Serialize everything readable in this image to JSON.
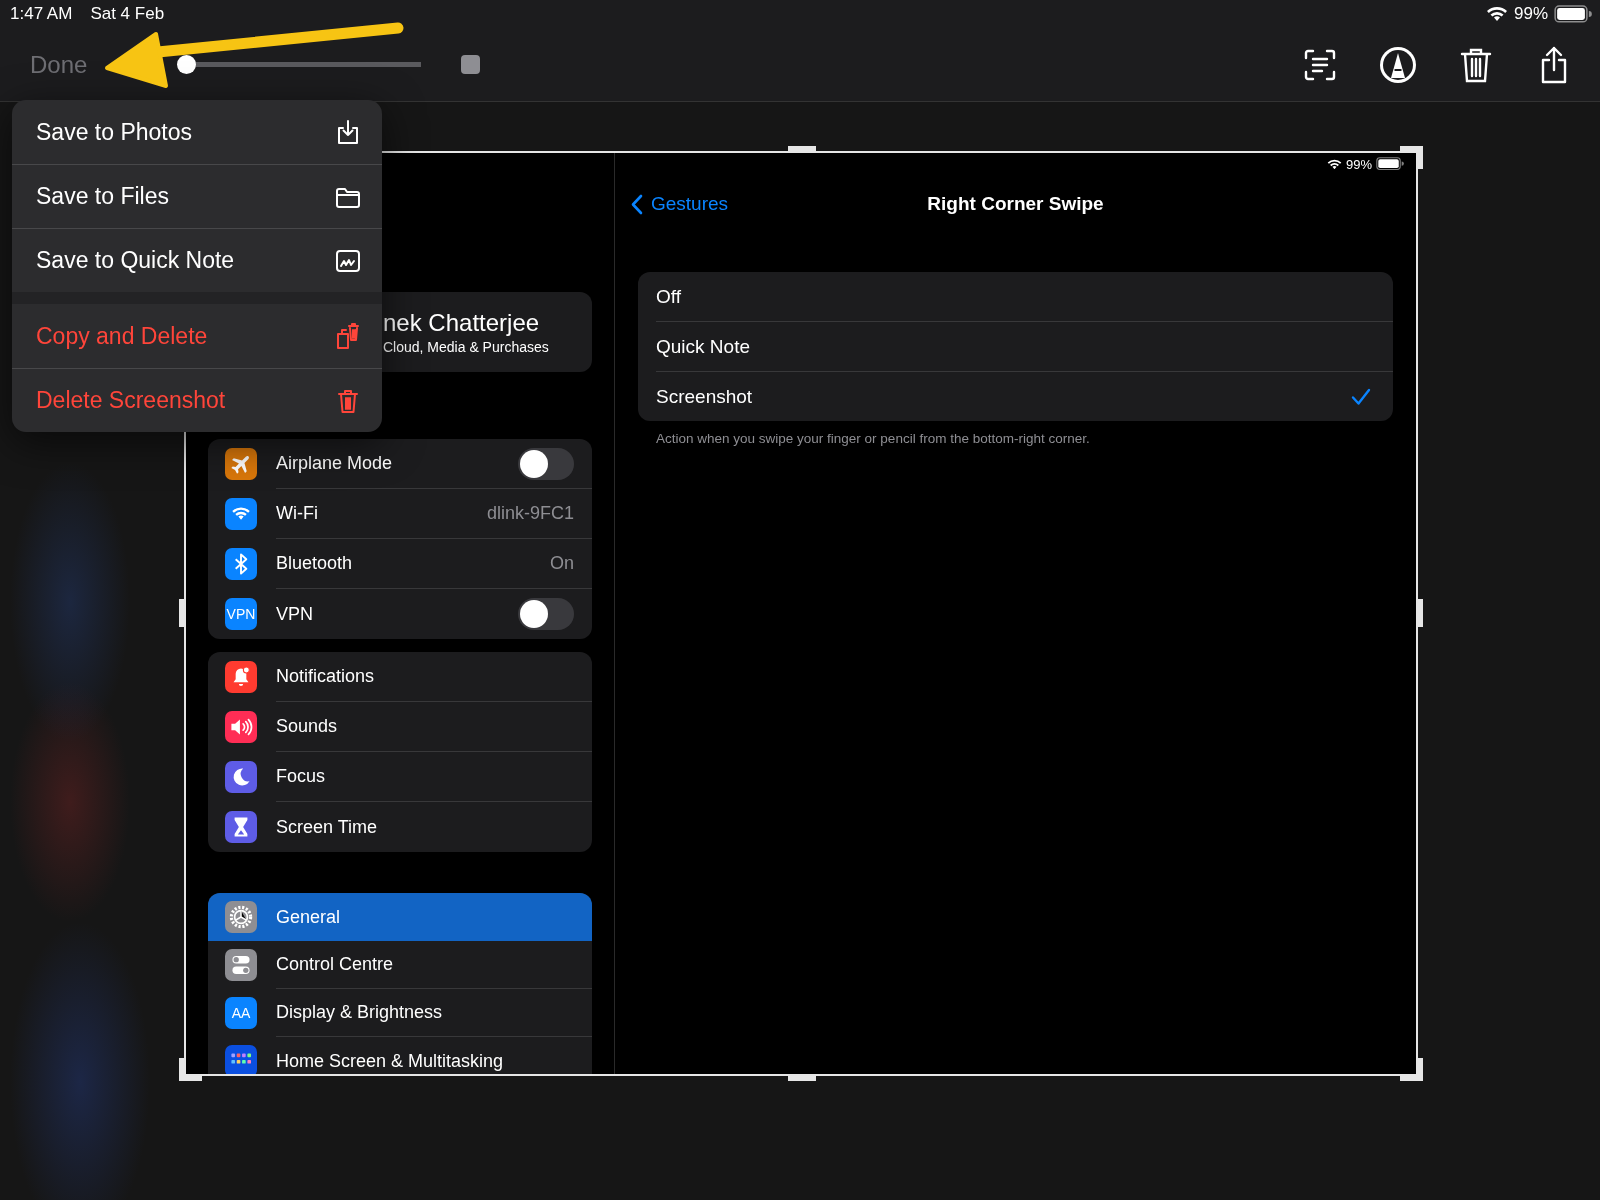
{
  "status_bar": {
    "time": "1:47 AM",
    "date": "Sat 4 Feb",
    "battery": "99%"
  },
  "toolbar": {
    "done": "Done",
    "slider": {
      "level": 0
    }
  },
  "menu": {
    "groups": [
      {
        "items": [
          {
            "label": "Save to Photos",
            "kind": "photos",
            "destructive": false
          },
          {
            "label": "Save to Files",
            "kind": "files",
            "destructive": false
          },
          {
            "label": "Save to Quick Note",
            "kind": "note",
            "destructive": false
          }
        ]
      },
      {
        "items": [
          {
            "label": "Copy and Delete",
            "kind": "copydelete",
            "destructive": true
          },
          {
            "label": "Delete Screenshot",
            "kind": "delete",
            "destructive": true
          }
        ]
      }
    ]
  },
  "preview": {
    "status_bar": {
      "battery": "99%"
    },
    "sidebar": {
      "account": {
        "name": "nek Chatterjee",
        "subtitle": "Cloud, Media & Purchases"
      },
      "groups": [
        {
          "items": [
            {
              "label": "Airplane Mode",
              "kind": "toggle",
              "on": false,
              "selected": false
            },
            {
              "label": "Wi-Fi",
              "kind": "value",
              "value": "dlink-9FC1",
              "selected": false
            },
            {
              "label": "Bluetooth",
              "kind": "value",
              "value": "On",
              "selected": false
            },
            {
              "label": "VPN",
              "kind": "toggle",
              "on": false,
              "icon_text": "VPN",
              "selected": false
            }
          ]
        },
        {
          "items": [
            {
              "label": "Notifications",
              "kind": "link",
              "selected": false
            },
            {
              "label": "Sounds",
              "kind": "link",
              "selected": false
            },
            {
              "label": "Focus",
              "kind": "link",
              "selected": false
            },
            {
              "label": "Screen Time",
              "kind": "link",
              "selected": false
            }
          ]
        },
        {
          "items": [
            {
              "label": "General",
              "kind": "link",
              "selected": true
            },
            {
              "label": "Control Centre",
              "kind": "link",
              "selected": false
            },
            {
              "label": "Display & Brightness",
              "kind": "link",
              "icon_text": "AA",
              "selected": false
            },
            {
              "label": "Home Screen & Multitasking",
              "kind": "link",
              "selected": false
            }
          ]
        }
      ]
    },
    "detail": {
      "back": "Gestures",
      "title": "Right Corner Swipe",
      "options": [
        {
          "label": "Off",
          "selected": false
        },
        {
          "label": "Quick Note",
          "selected": false
        },
        {
          "label": "Screenshot",
          "selected": true
        }
      ],
      "footer": "Action when you swipe your finger or pencil from the bottom-right corner."
    }
  }
}
